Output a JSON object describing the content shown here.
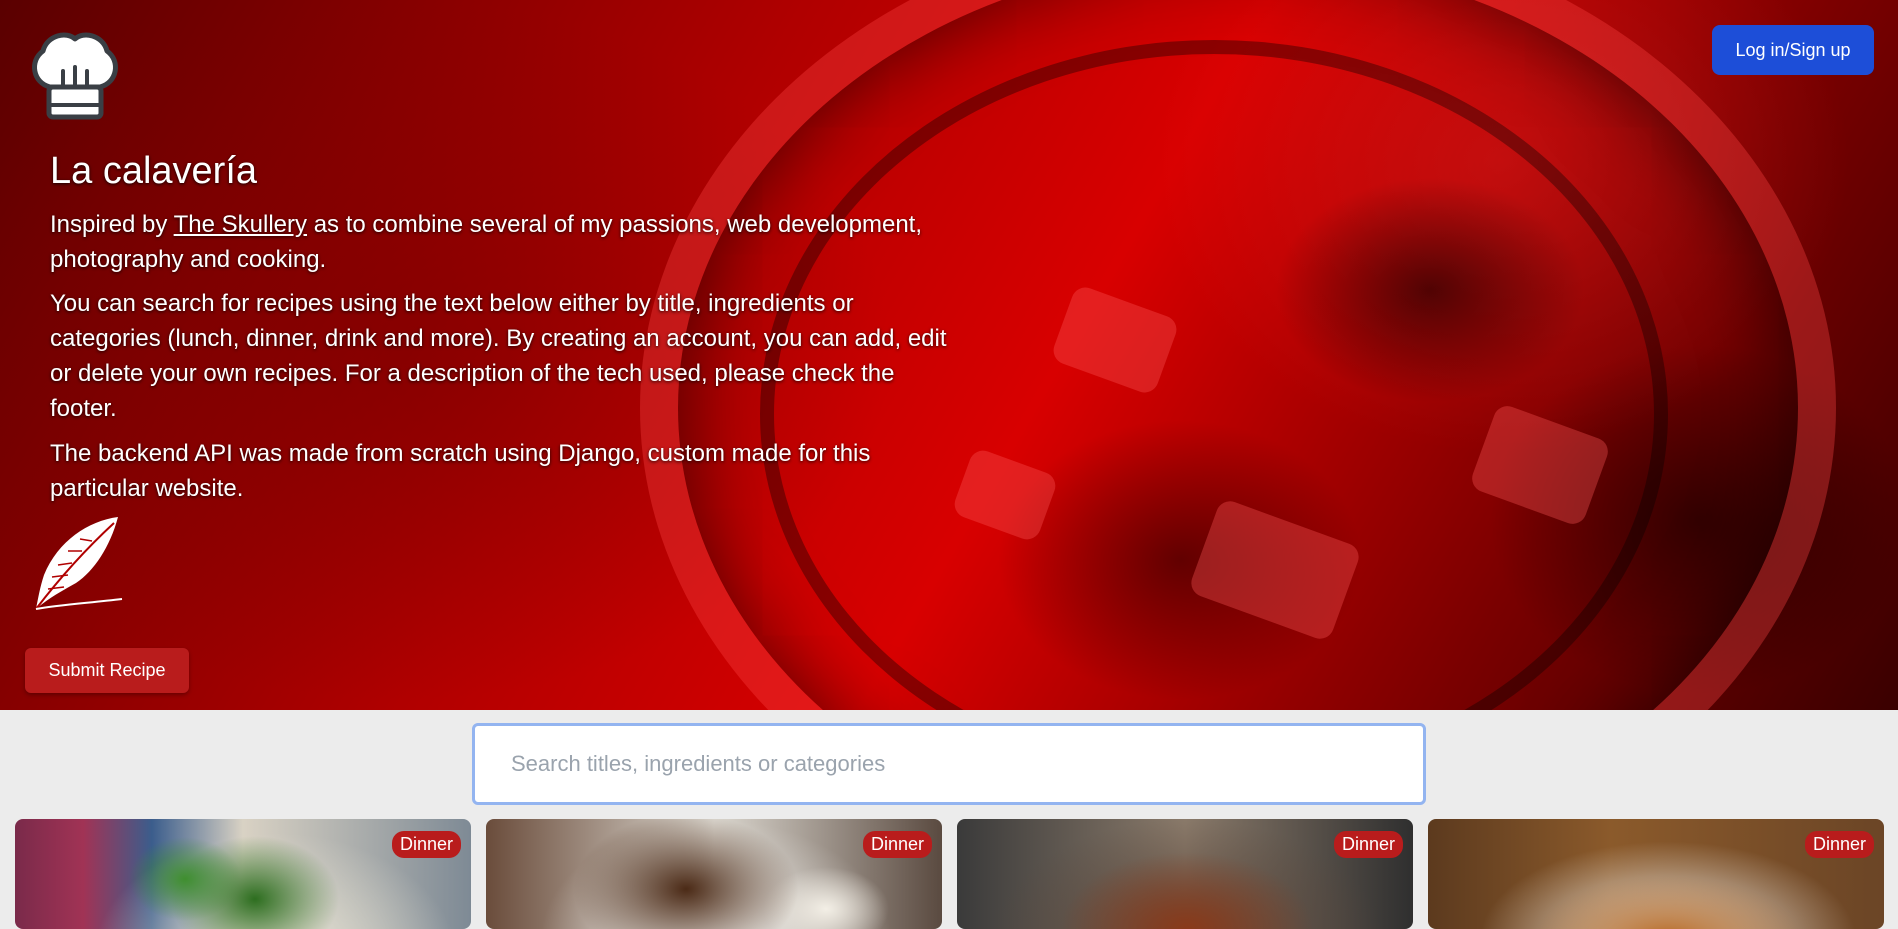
{
  "header": {
    "login_label": "Log in/Sign up",
    "site_title": "La calavería",
    "intro_prefix": "Inspired by ",
    "intro_link": "The Skullery",
    "intro_suffix": " as to combine several of my passions, web development, photography and cooking.",
    "paragraph_search": "You can search for recipes using the text below either by title, ingredients or categories (lunch, dinner, drink and more). By creating an account, you can add, edit or delete your own recipes. For a description of the tech used, please check the footer.",
    "paragraph_backend": "The backend API was made from scratch using Django, custom made for this particular website.",
    "submit_label": "Submit Recipe",
    "logo_icon": "chef-hat-icon",
    "submit_icon": "feather-quill-icon"
  },
  "search": {
    "placeholder": "Search titles, ingredients or categories",
    "value": ""
  },
  "recipes": [
    {
      "category": "Dinner"
    },
    {
      "category": "Dinner"
    },
    {
      "category": "Dinner"
    },
    {
      "category": "Dinner"
    }
  ],
  "colors": {
    "accent_red": "#b91c1c",
    "login_blue": "#1d4ed8",
    "page_bg": "#ececec"
  }
}
